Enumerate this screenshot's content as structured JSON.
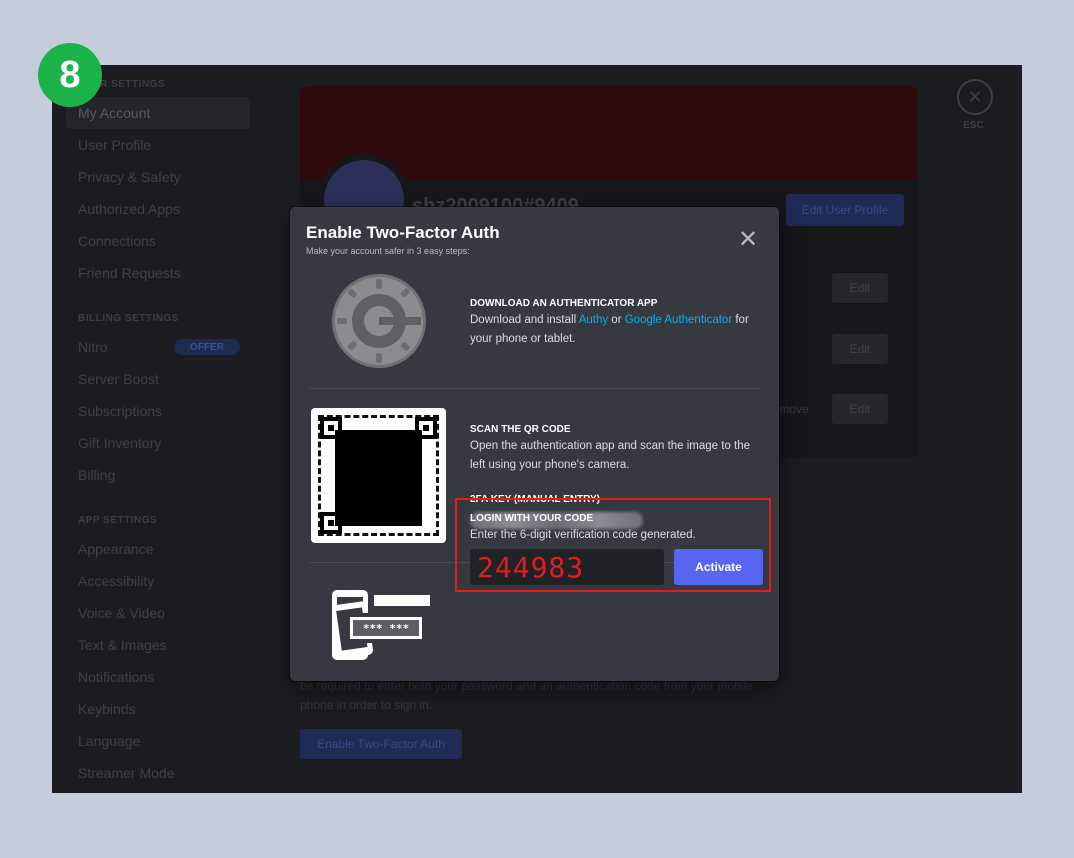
{
  "step_number": "8",
  "sidebar": {
    "user_settings_header": "USER SETTINGS",
    "user_items": [
      "My Account",
      "User Profile",
      "Privacy & Safety",
      "Authorized Apps",
      "Connections",
      "Friend Requests"
    ],
    "billing_header": "BILLING SETTINGS",
    "billing_items": [
      "Nitro",
      "Server Boost",
      "Subscriptions",
      "Gift Inventory",
      "Billing"
    ],
    "offer_badge": "OFFER",
    "app_header": "APP SETTINGS",
    "app_items": [
      "Appearance",
      "Accessibility",
      "Voice & Video",
      "Text & Images",
      "Notifications",
      "Keybinds",
      "Language",
      "Streamer Mode"
    ]
  },
  "background": {
    "username": "shz2009100#9409",
    "edit_profile_label": "Edit User Profile",
    "edit_label": "Edit",
    "remove_label": "Remove",
    "esc_label": "ESC",
    "tfa_text": "be required to enter both your password and an authentication code from your mobile phone in order to sign in.",
    "enable_tfa_label": "Enable Two-Factor Auth"
  },
  "modal": {
    "title": "Enable Two-Factor Auth",
    "subtitle": "Make your account safer in 3 easy steps:",
    "step1": {
      "title": "DOWNLOAD AN AUTHENTICATOR APP",
      "desc_pre": "Download and install ",
      "link1": "Authy",
      "desc_mid": " or ",
      "link2": "Google Authenticator",
      "desc_post": " for your phone or tablet."
    },
    "step2": {
      "title": "SCAN THE QR CODE",
      "desc": "Open the authentication app and scan the image to the left using your phone's camera.",
      "key_title": "2FA KEY (MANUAL ENTRY)"
    },
    "step3": {
      "title": "LOGIN WITH YOUR CODE",
      "desc": "Enter the 6-digit verification code generated.",
      "code_value": "244983",
      "phone_code_text": "*** ***",
      "activate_label": "Activate"
    }
  },
  "colors": {
    "accent": "#5865f2",
    "highlight": "#e31b1b",
    "link": "#00b0f4",
    "badge": "#1db34b"
  }
}
